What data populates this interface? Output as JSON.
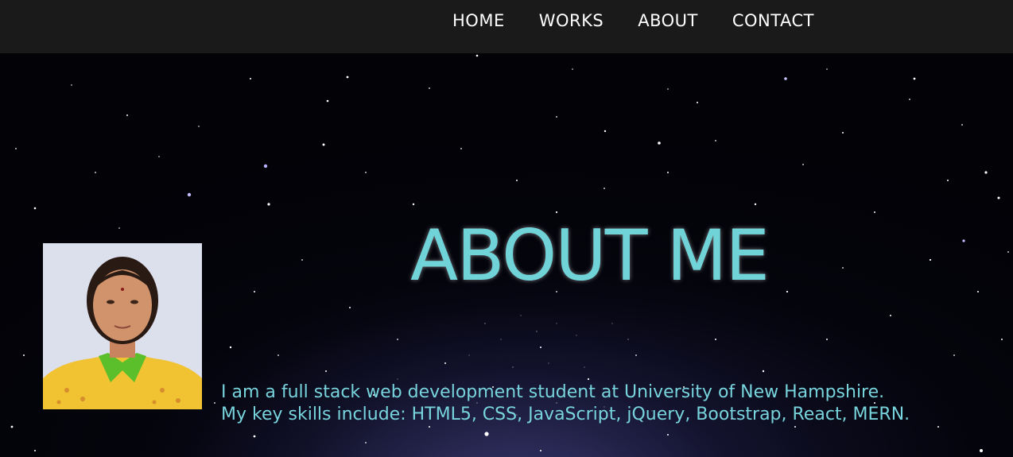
{
  "nav": {
    "items": [
      {
        "label": "HOME"
      },
      {
        "label": "WORKS"
      },
      {
        "label": "ABOUT"
      },
      {
        "label": "CONTACT"
      }
    ]
  },
  "about": {
    "title": "ABOUT ME",
    "bio_line_1": "I am a full stack web development student at University of New Hampshire.",
    "bio_line_2": "My key skills include: HTML5, CSS, JavaScript, jQuery, Bootstrap, React, MERN."
  },
  "colors": {
    "navbar_bg": "#1b1a1a",
    "accent_teal": "#6fd3d8",
    "sky_bg": "#020207"
  }
}
